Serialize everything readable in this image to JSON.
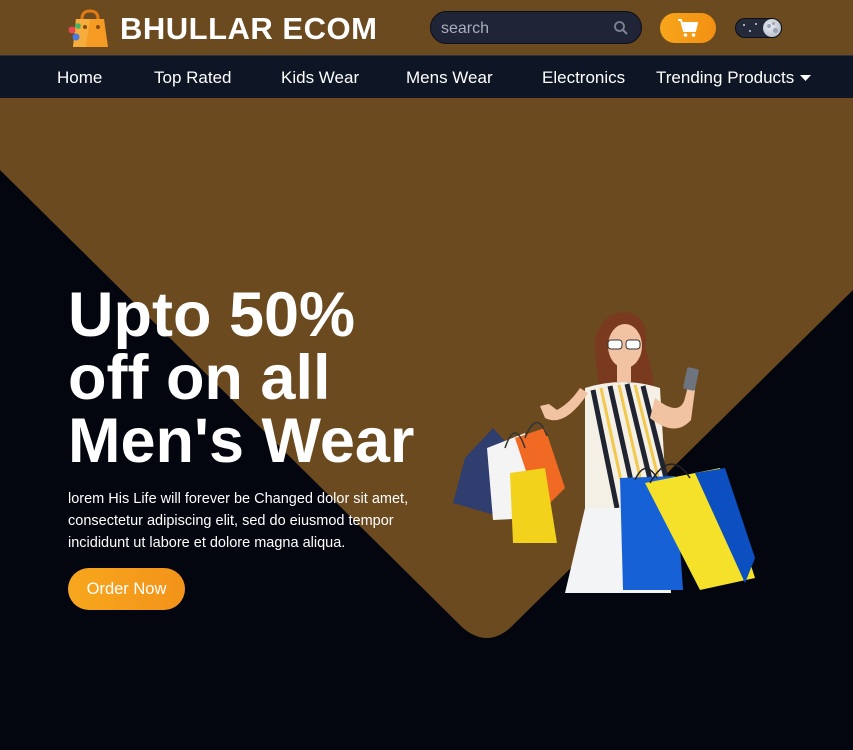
{
  "header": {
    "brand": "BHULLAR ECOM",
    "search_placeholder": "search",
    "icons": {
      "logo": "shopping-bag-logo",
      "search": "search-icon",
      "cart": "cart-icon",
      "theme_toggle": "moon-toggle"
    }
  },
  "nav": {
    "items": [
      {
        "label": "Home"
      },
      {
        "label": "Top Rated"
      },
      {
        "label": "Kids Wear"
      },
      {
        "label": "Mens Wear"
      },
      {
        "label": "Electronics"
      },
      {
        "label": "Trending Products"
      }
    ]
  },
  "hero": {
    "title_lines": [
      "Upto 50%",
      "off on all",
      "Men's Wear"
    ],
    "description": "lorem His Life will forever be Changed dolor sit amet, consectetur adipiscing elit, sed do eiusmod tempor incididunt ut labore et dolore magna aliqua.",
    "cta_label": "Order Now"
  },
  "colors": {
    "header_bg": "#6b4a1f",
    "nav_bg": "#0e1524",
    "hero_bg": "#03060f",
    "accent": "#f5a11a"
  }
}
